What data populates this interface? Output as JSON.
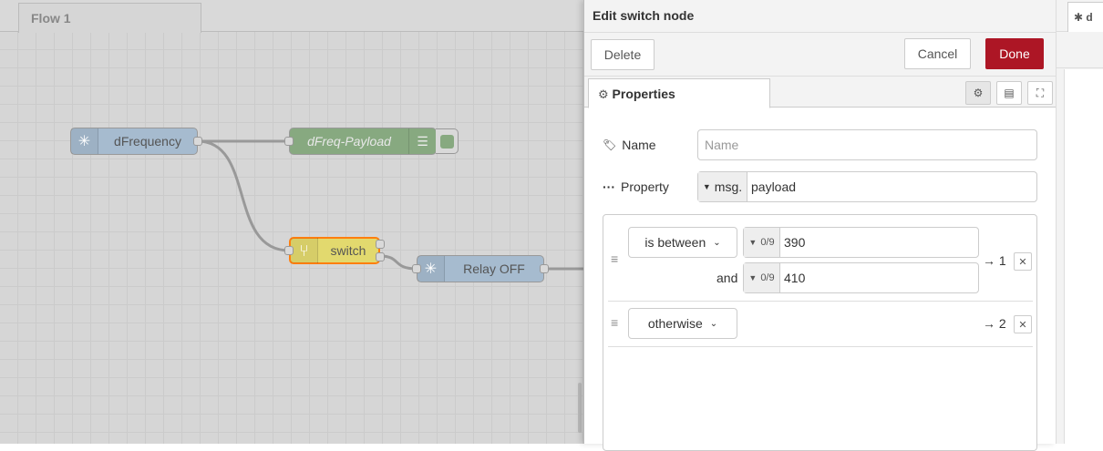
{
  "workspace": {
    "tab_label": "Flow 1",
    "nodes": {
      "dfrequency": "dFrequency",
      "dfreq_payload": "dFreq-Payload",
      "switch": "switch",
      "relay_off": "Relay OFF"
    },
    "colors": {
      "inject_node": "#a6bbcf",
      "debug_node": "#87a980",
      "switch_node": "#e2d96e",
      "switch_border": "#ff7f0e"
    }
  },
  "dialog": {
    "title": "Edit switch node",
    "delete_label": "Delete",
    "cancel_label": "Cancel",
    "done_label": "Done",
    "tabs": {
      "properties_label": "Properties",
      "icons": [
        "gear-icon",
        "document-icon",
        "frame-icon"
      ]
    },
    "name_label": "Name",
    "name_placeholder": "Name",
    "property_label": "Property",
    "property_prefix": "msg.",
    "property_value": "payload",
    "rules": [
      {
        "operator": "is between",
        "value1_type": "0/9",
        "value1": "390",
        "and_label": "and",
        "value2_type": "0/9",
        "value2": "410",
        "output": "→ 1"
      },
      {
        "operator": "otherwise",
        "output": "→ 2"
      }
    ],
    "colors": {
      "done_button": "#ad1625"
    }
  },
  "sidebar": {
    "tab_label": "d"
  }
}
